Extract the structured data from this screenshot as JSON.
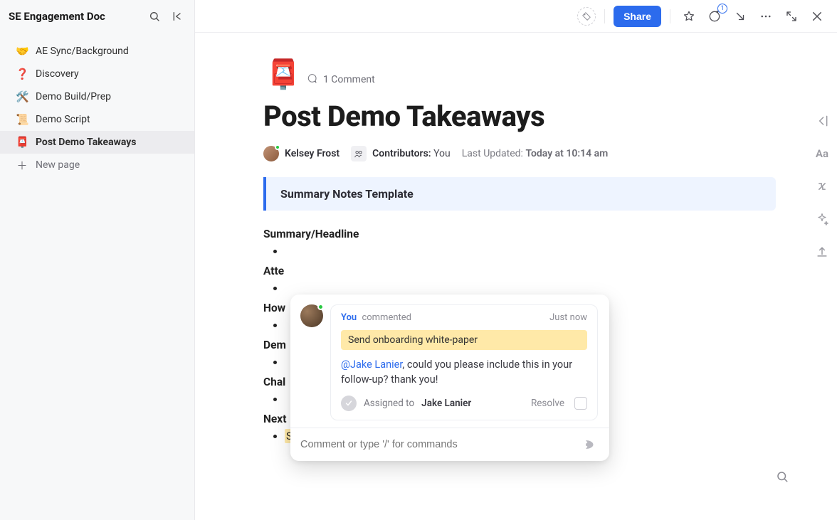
{
  "sidebar": {
    "title": "SE Engagement Doc",
    "items": [
      {
        "emoji": "🤝",
        "label": "AE Sync/Background"
      },
      {
        "emoji": "❓",
        "label": "Discovery"
      },
      {
        "emoji": "🛠️",
        "label": "Demo Build/Prep"
      },
      {
        "emoji": "📜",
        "label": "Demo Script"
      },
      {
        "emoji": "📮",
        "label": "Post Demo Takeaways",
        "active": true
      }
    ],
    "new_page_label": "New page"
  },
  "topbar": {
    "share_label": "Share",
    "notification_count": "1"
  },
  "page": {
    "emoji": "📮",
    "comment_count_label": "1 Comment",
    "title": "Post Demo Takeaways",
    "author_name": "Kelsey Frost",
    "contributors_label": "Contributors:",
    "contributors_value": "You",
    "updated_label": "Last Updated:",
    "updated_value": "Today at 10:14 am",
    "callout_title": "Summary Notes Template",
    "sections": {
      "s1": "Summary/Headline",
      "s2": "Atte",
      "s3": "How",
      "s4": "Dem",
      "s5": "Chal",
      "s6": "Next"
    },
    "next_step_item": "Send onboarding white-paper"
  },
  "popover": {
    "you_label": "You",
    "action_label": "commented",
    "time_label": "Just now",
    "quoted_text": "Send onboarding white-paper",
    "mention_name": "@Jake Lanier",
    "body_tail": ", could you please include this in your follow-up? thank you!",
    "assigned_label": "Assigned to",
    "assignee_name": "Jake Lanier",
    "resolve_label": "Resolve",
    "input_placeholder": "Comment or type '/' for commands"
  },
  "right_rail": {
    "aa_label": "Aa"
  }
}
